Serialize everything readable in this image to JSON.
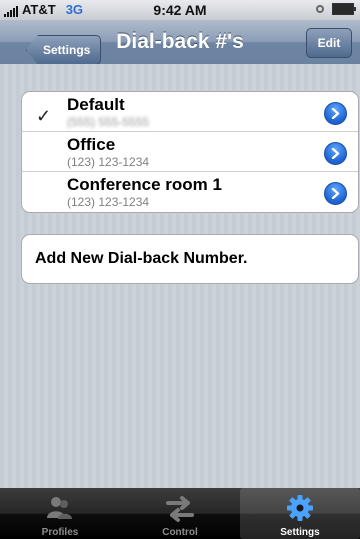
{
  "status_bar": {
    "carrier": "AT&T",
    "network": "3G",
    "time": "9:42 AM"
  },
  "nav": {
    "back_label": "Settings",
    "title": "Dial-back #'s",
    "edit_label": "Edit"
  },
  "numbers": [
    {
      "name": "Default",
      "number": "(555) 555-5555",
      "selected": true
    },
    {
      "name": "Office",
      "number": "(123) 123-1234",
      "selected": false
    },
    {
      "name": "Conference room 1",
      "number": "(123) 123-1234",
      "selected": false
    }
  ],
  "add_label": "Add New Dial-back Number.",
  "tabs": [
    {
      "label": "Profiles",
      "icon": "profiles-icon",
      "active": false
    },
    {
      "label": "Control",
      "icon": "arrows-icon",
      "active": false
    },
    {
      "label": "Settings",
      "icon": "gear-icon",
      "active": true
    }
  ],
  "colors": {
    "nav_bar": "#6d84a2",
    "disclosure": "#1b62d4",
    "network": "#2f6fd3"
  }
}
